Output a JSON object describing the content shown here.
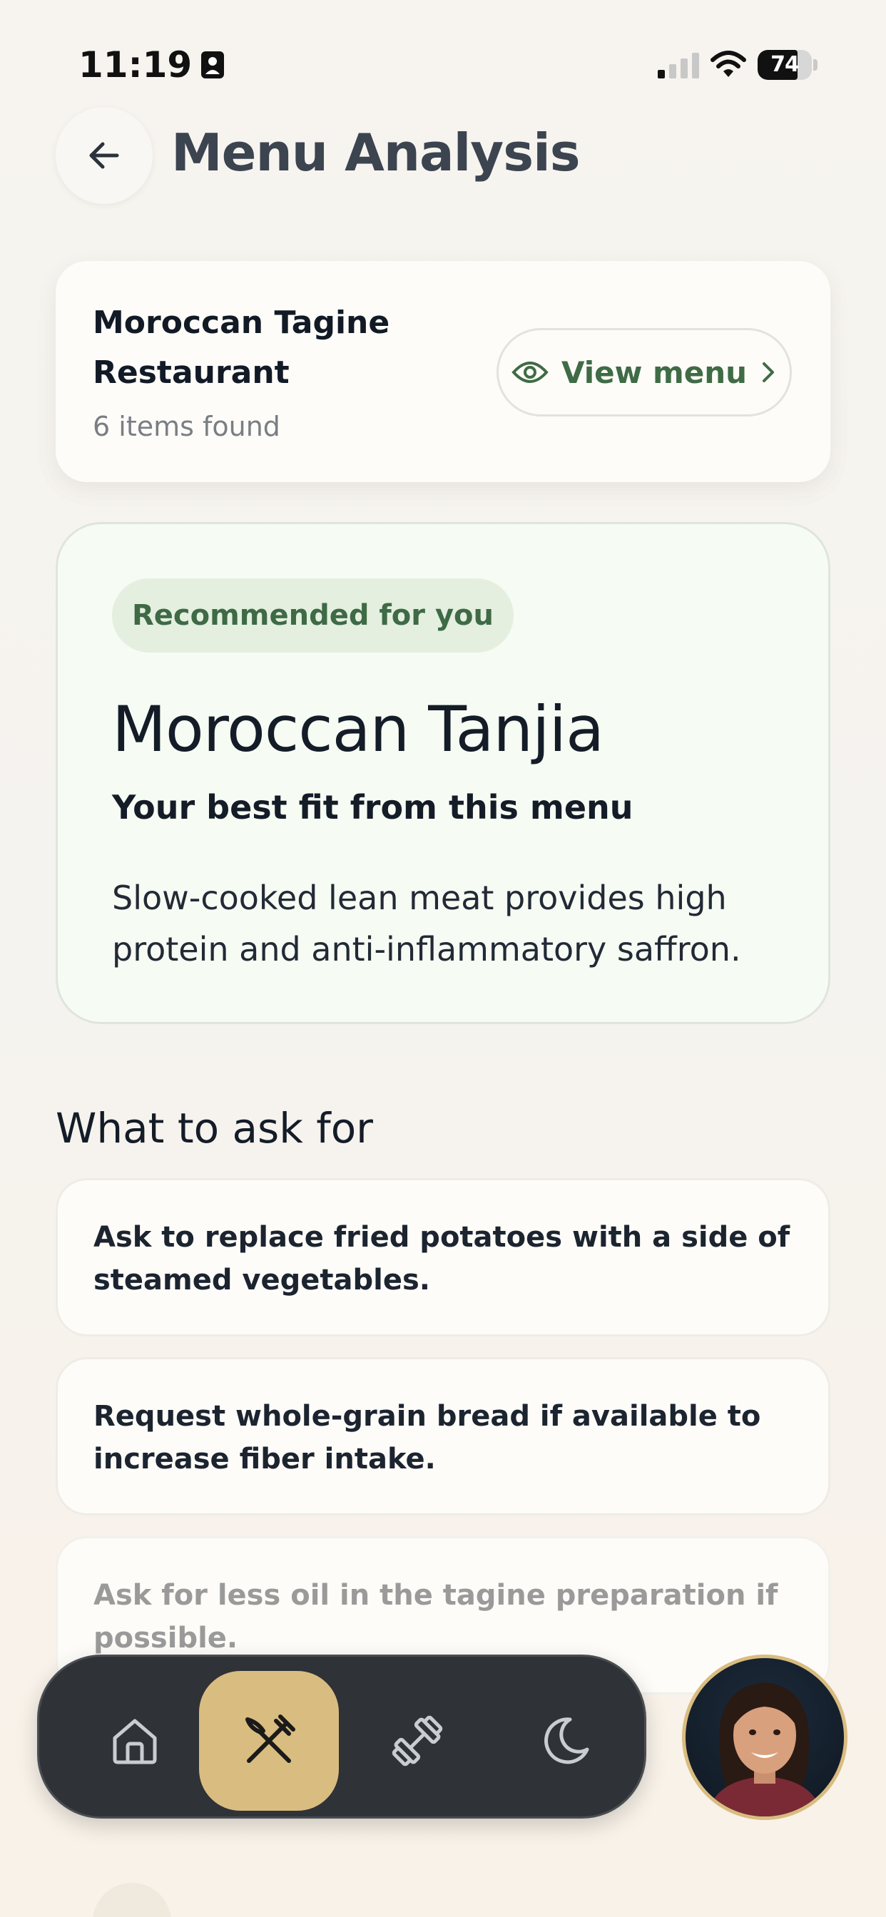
{
  "status_bar": {
    "time": "11:19",
    "battery_level": "74",
    "battery_fraction": 0.74
  },
  "header": {
    "title": "Menu Analysis"
  },
  "restaurant": {
    "name": "Moroccan Tagine Restaurant",
    "items_found": "6 items found",
    "view_menu_label": "View menu"
  },
  "recommendation": {
    "badge": "Recommended for you",
    "dish": "Moroccan Tanjia",
    "subtitle": "Your best fit from this menu",
    "reason": "Slow-cooked lean meat provides high protein and anti-inflammatory saffron."
  },
  "ask_section": {
    "title": "What to ask for",
    "tips": [
      "Ask to replace fried potatoes with a side of steamed vegetables.",
      "Request whole-grain bread if available to increase fiber intake.",
      "Ask for less oil in the tagine preparation if possible."
    ]
  },
  "nav": {
    "tabs": [
      {
        "icon": "home-icon",
        "active": false
      },
      {
        "icon": "fork-knife-icon",
        "active": true
      },
      {
        "icon": "dumbbell-icon",
        "active": false
      },
      {
        "icon": "moon-icon",
        "active": false
      }
    ],
    "accent": "#d9bc80",
    "bar_color": "#2f3237"
  },
  "colors": {
    "accent_green": "#3f6b45",
    "badge_bg": "#e4efe0",
    "card_bg": "#fdfcf8"
  }
}
